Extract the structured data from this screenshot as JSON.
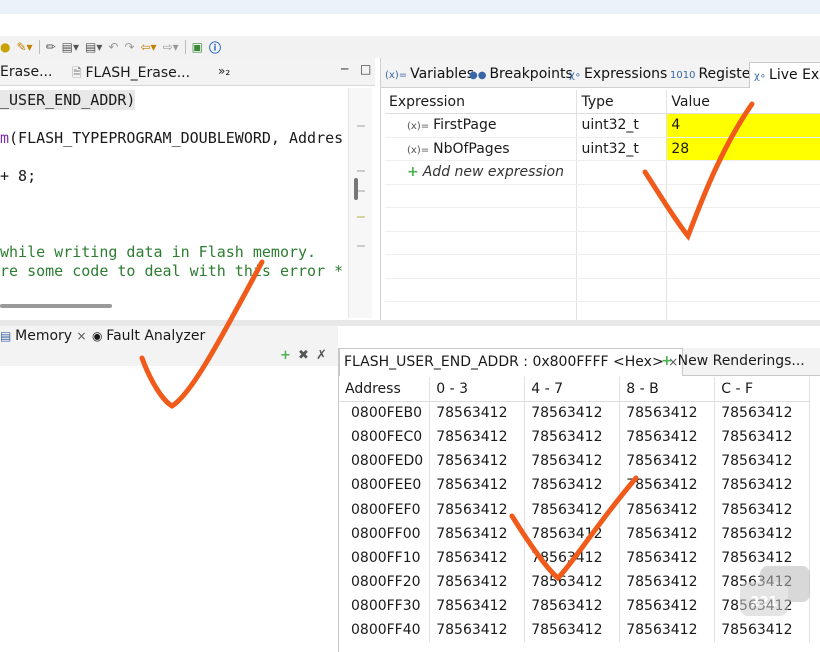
{
  "editor": {
    "tabs": [
      {
        "label": "Erase..."
      },
      {
        "label": "FLASH_Erase..."
      },
      {
        "label": "»₂"
      }
    ],
    "code_lines": [
      {
        "text": "_USER_END_ADDR)"
      },
      {
        "text": "m(FLASH_TYPEPROGRAM_DOUBLEWORD, Addres"
      },
      {
        "text": "+ 8;"
      },
      {
        "text": "while writing data in Flash memory."
      },
      {
        "text": "re some code to deal with this error *"
      }
    ]
  },
  "view_tabs": {
    "items": [
      {
        "label": "Variables",
        "icon": "variables-icon"
      },
      {
        "label": "Breakpoints",
        "icon": "breakpoints-icon"
      },
      {
        "label": "Expressions",
        "icon": "expressions-icon"
      },
      {
        "label": "Registers",
        "icon": "registers-icon"
      },
      {
        "label": "Live Exp",
        "icon": "live-expressions-icon"
      }
    ]
  },
  "live_expressions": {
    "headers": [
      "Expression",
      "Type",
      "Value"
    ],
    "rows": [
      {
        "expression": "FirstPage",
        "type": "uint32_t",
        "value": "4"
      },
      {
        "expression": "NbOfPages",
        "type": "uint32_t",
        "value": "28"
      }
    ],
    "add_label": "Add new expression",
    "highlight_color": "#ffff00"
  },
  "bottom_tabs": {
    "memory_label": "Memory",
    "fault_label": "Fault Analyzer"
  },
  "memory": {
    "render_tab": "FLASH_USER_END_ADDR : 0x800FFFF <Hex>",
    "new_renderings": "New Renderings...",
    "headers": [
      "Address",
      "0 - 3",
      "4 - 7",
      "8 - B",
      "C - F"
    ],
    "rows": [
      {
        "addr": "0800FEB0",
        "v": [
          "78563412",
          "78563412",
          "78563412",
          "78563412"
        ]
      },
      {
        "addr": "0800FEC0",
        "v": [
          "78563412",
          "78563412",
          "78563412",
          "78563412"
        ]
      },
      {
        "addr": "0800FED0",
        "v": [
          "78563412",
          "78563412",
          "78563412",
          "78563412"
        ]
      },
      {
        "addr": "0800FEE0",
        "v": [
          "78563412",
          "78563412",
          "78563412",
          "78563412"
        ]
      },
      {
        "addr": "0800FEF0",
        "v": [
          "78563412",
          "78563412",
          "78563412",
          "78563412"
        ]
      },
      {
        "addr": "0800FF00",
        "v": [
          "78563412",
          "78563412",
          "78563412",
          "78563412"
        ]
      },
      {
        "addr": "0800FF10",
        "v": [
          "78563412",
          "78563412",
          "78563412",
          "78563412"
        ]
      },
      {
        "addr": "0800FF20",
        "v": [
          "78563412",
          "78563412",
          "78563412",
          "78563412"
        ]
      },
      {
        "addr": "0800FF30",
        "v": [
          "78563412",
          "78563412",
          "78563412",
          "78563412"
        ]
      },
      {
        "addr": "0800FF40",
        "v": [
          "78563412",
          "78563412",
          "78563412",
          "78563412"
        ]
      }
    ]
  },
  "colors": {
    "annotation": "#f05a1a",
    "tab_bg": "#f3f3f3"
  }
}
